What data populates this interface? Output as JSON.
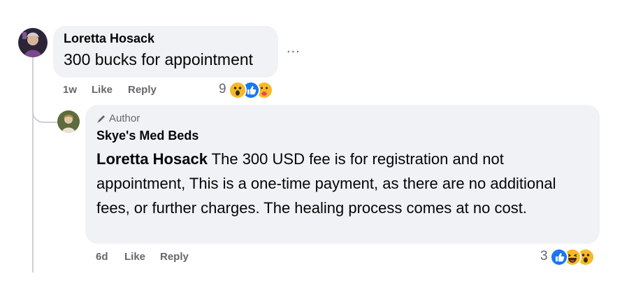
{
  "comments": [
    {
      "author": "Loretta Hosack",
      "text": "300 bucks for appointment",
      "time": "1w",
      "like_label": "Like",
      "reply_label": "Reply",
      "reaction_count": "9",
      "reactions": [
        "wow",
        "like",
        "care"
      ],
      "more_label": "..."
    },
    {
      "badge": "Author",
      "author": "Skye's Med Beds",
      "mention": "Loretta Hosack",
      "text": " The 300 USD fee is for registration and not appointment, This is a one-time payment, as there are no additional fees, or further charges. The healing process comes at no cost.",
      "time": "6d",
      "like_label": "Like",
      "reply_label": "Reply",
      "reaction_count": "3",
      "reactions": [
        "like",
        "haha",
        "wow"
      ]
    }
  ],
  "colors": {
    "bubble": "#f0f2f5",
    "secondary_text": "#65676b",
    "like_blue": "#1877f2",
    "emoji_yellow": "#f7b928",
    "thread_line": "#ced0d4"
  }
}
